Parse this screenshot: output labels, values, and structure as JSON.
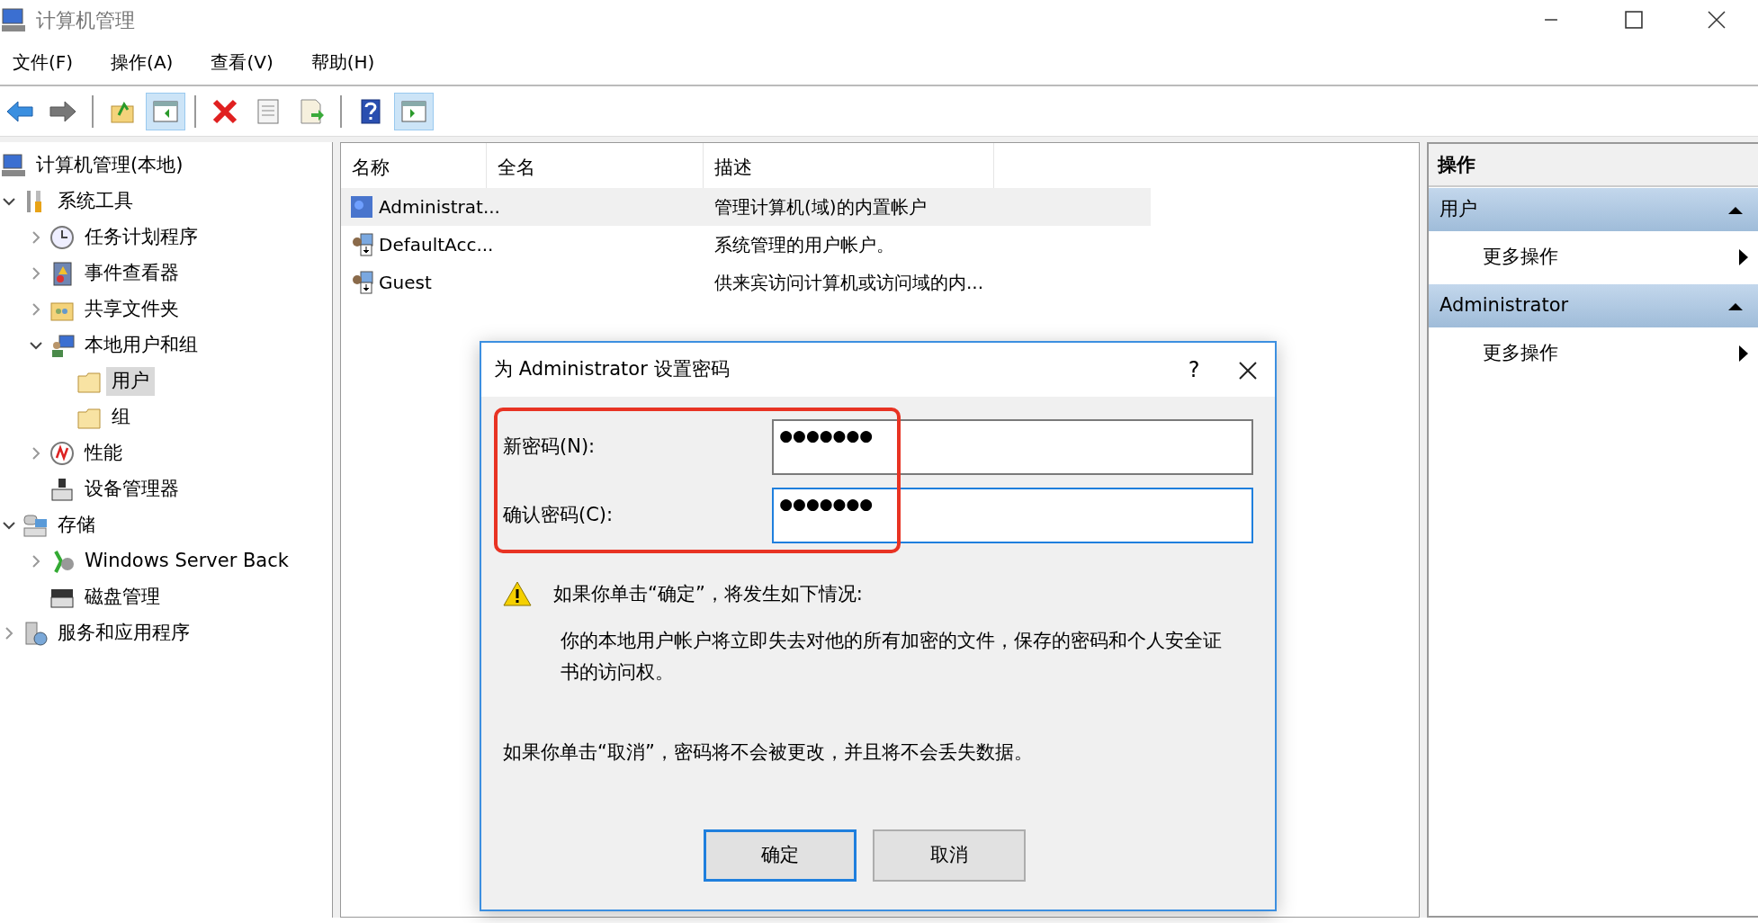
{
  "window": {
    "title": "计算机管理"
  },
  "menu": [
    "文件(F)",
    "操作(A)",
    "查看(V)",
    "帮助(H)"
  ],
  "toolbar": [
    {
      "kind": "back",
      "active": false
    },
    {
      "kind": "forward",
      "active": false
    },
    {
      "kind": "sep"
    },
    {
      "kind": "up",
      "active": false
    },
    {
      "kind": "tree",
      "active": true
    },
    {
      "kind": "sep"
    },
    {
      "kind": "delete",
      "active": false
    },
    {
      "kind": "properties",
      "active": false
    },
    {
      "kind": "export",
      "active": false
    },
    {
      "kind": "sep"
    },
    {
      "kind": "help",
      "active": false
    },
    {
      "kind": "pane",
      "active": true
    }
  ],
  "tree": [
    {
      "label": "计算机管理(本地)",
      "selected": false,
      "children": [
        {
          "label": "系统工具",
          "expanded": true,
          "selected": false,
          "children": [
            {
              "label": "任务计划程序",
              "expanded": false,
              "selected": false
            },
            {
              "label": "事件查看器",
              "expanded": false,
              "selected": false
            },
            {
              "label": "共享文件夹",
              "expanded": false,
              "selected": false
            },
            {
              "label": "本地用户和组",
              "expanded": true,
              "selected": false,
              "children": [
                {
                  "label": "用户",
                  "selected": true
                },
                {
                  "label": "组",
                  "selected": false
                }
              ]
            },
            {
              "label": "性能",
              "expanded": false,
              "selected": false
            },
            {
              "label": "设备管理器",
              "selected": false
            }
          ]
        },
        {
          "label": "存储",
          "expanded": true,
          "selected": false,
          "children": [
            {
              "label": "Windows Server Back",
              "expanded": false,
              "selected": false
            },
            {
              "label": "磁盘管理",
              "selected": false
            }
          ]
        },
        {
          "label": "服务和应用程序",
          "expanded": false,
          "selected": false
        }
      ]
    }
  ],
  "table": {
    "columns": [
      "名称",
      "全名",
      "描述"
    ],
    "rows": [
      {
        "name": "Administrat...",
        "description": "管理计算机(域)的内置帐户",
        "selected": true
      },
      {
        "name": "DefaultAcc...",
        "description": "系统管理的用户帐户。",
        "selected": false
      },
      {
        "name": "Guest",
        "description": "供来宾访问计算机或访问域的内...",
        "selected": false
      }
    ]
  },
  "actions": {
    "title": "操作",
    "groups": [
      {
        "title": "用户",
        "expanded": true,
        "items": [
          "更多操作"
        ]
      },
      {
        "title": "Administrator",
        "expanded": true,
        "items": [
          "更多操作"
        ]
      }
    ]
  },
  "dialog": {
    "title": "为 Administrator 设置密码",
    "help": "?",
    "highlighted": true,
    "fields": [
      {
        "label": "新密码(N):",
        "value": "●●●●●●●",
        "focused": false
      },
      {
        "label": "确认密码(C):",
        "value": "●●●●●●●",
        "focused": true
      }
    ],
    "warning": "如果你单击“确定”，将发生如下情况:",
    "details": "你的本地用户帐户将立即失去对他的所有加密的文件，保存的密码和个人安全证书的访问权。",
    "cancel_note": "如果你单击“取消”，密码将不会被更改，并且将不会丢失数据。",
    "buttons": [
      {
        "label": "确定",
        "default": true
      },
      {
        "label": "取消",
        "default": false
      }
    ]
  }
}
